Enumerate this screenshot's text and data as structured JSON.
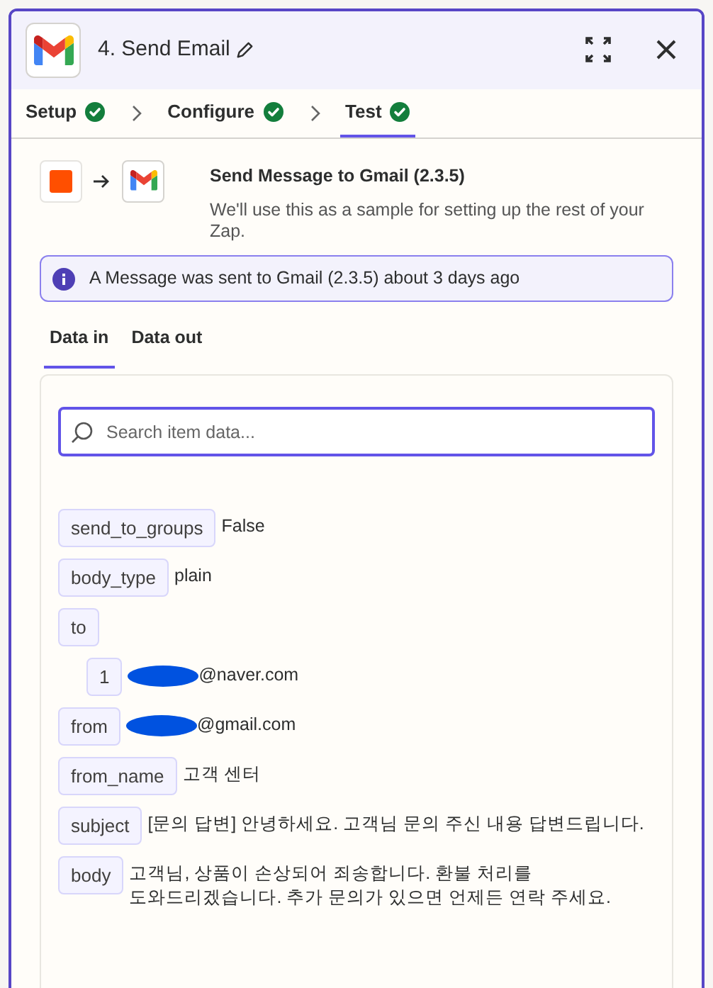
{
  "header": {
    "title": "4. Send Email"
  },
  "steps": [
    {
      "label": "Setup",
      "done": true,
      "selected": false
    },
    {
      "label": "Configure",
      "done": true,
      "selected": false
    },
    {
      "label": "Test",
      "done": true,
      "selected": true
    }
  ],
  "sample": {
    "title": "Send Message to Gmail (2.3.5)",
    "description": "We'll use this as a sample for setting up the rest of your Zap."
  },
  "notice": "A Message was sent to Gmail (2.3.5) about 3 days ago",
  "data_tabs": [
    {
      "label": "Data in",
      "selected": true
    },
    {
      "label": "Data out",
      "selected": false
    }
  ],
  "search": {
    "placeholder": "Search item data..."
  },
  "items": [
    {
      "key": "send_to_groups",
      "value": "False",
      "redacted": false
    },
    {
      "key": "body_type",
      "value": "plain",
      "redacted": false
    },
    {
      "key": "to",
      "children": [
        {
          "key": "1",
          "value": "@naver.com",
          "redacted": true
        }
      ]
    },
    {
      "key": "from",
      "value": "@gmail.com",
      "redacted": true
    },
    {
      "key": "from_name",
      "value": "고객 센터",
      "redacted": false
    },
    {
      "key": "subject",
      "value": "[문의 답변] 안녕하세요. 고객님 문의 주신 내용 답변드립니다.",
      "redacted": false
    },
    {
      "key": "body",
      "value": "고객님, 상품이 손상되어 죄송합니다. 환불 처리를 도와드리겠습니다. 추가 문의가 있으면 언제든 연락 주세요.",
      "redacted": false
    }
  ]
}
